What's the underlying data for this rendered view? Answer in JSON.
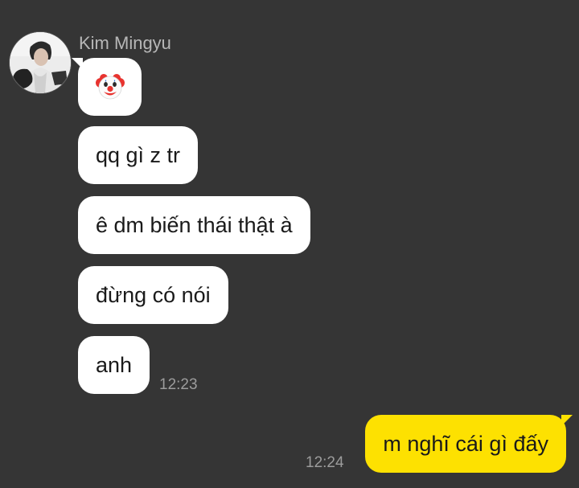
{
  "contact": {
    "name": "Kim Mingyu",
    "avatar_icon": "profile-photo"
  },
  "messages_in": [
    {
      "type": "emoji",
      "icon": "clown-face-icon"
    },
    {
      "type": "text",
      "text": "qq gì z tr"
    },
    {
      "type": "text",
      "text": "ê dm biến thái thật à"
    },
    {
      "type": "text",
      "text": "đừng có nói"
    },
    {
      "type": "text",
      "text": "anh"
    }
  ],
  "incoming_time": "12:23",
  "message_out": {
    "text": "m nghĩ cái gì đấy",
    "time": "12:24"
  },
  "colors": {
    "background": "#353535",
    "incoming_bubble": "#ffffff",
    "outgoing_bubble": "#fde101",
    "meta_text": "#9c9c9c"
  }
}
